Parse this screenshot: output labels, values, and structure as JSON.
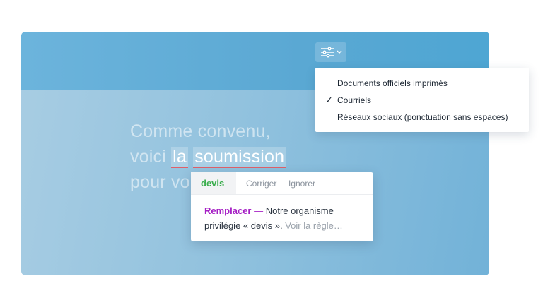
{
  "toolbar": {
    "settings_icon": "sliders-icon",
    "dropdown_icon": "chevron-down-icon"
  },
  "editor": {
    "line1": "Comme convenu,",
    "line2_prefix": "voici ",
    "word1": "la",
    "word2": "soumission",
    "line3_visible": "pour vo"
  },
  "dropdown": {
    "items": [
      {
        "label": "Documents officiels imprimés",
        "checked": false
      },
      {
        "label": "Courriels",
        "checked": true
      },
      {
        "label": "Réseaux sociaux (ponctuation sans espaces)",
        "checked": false
      }
    ],
    "check_mark": "✓"
  },
  "popup": {
    "suggestion": "devis",
    "correct_label": "Corriger",
    "ignore_label": "Ignorer",
    "action": "Remplacer",
    "dash": " — ",
    "message": "Notre organisme privilégie « devis ».",
    "rule_link": "Voir la règle…"
  },
  "colors": {
    "accent_green": "#3cae4e",
    "accent_purple": "#a51fc4",
    "error_underline": "#e0606a",
    "toolbar_blue": "#5aa8d3"
  }
}
